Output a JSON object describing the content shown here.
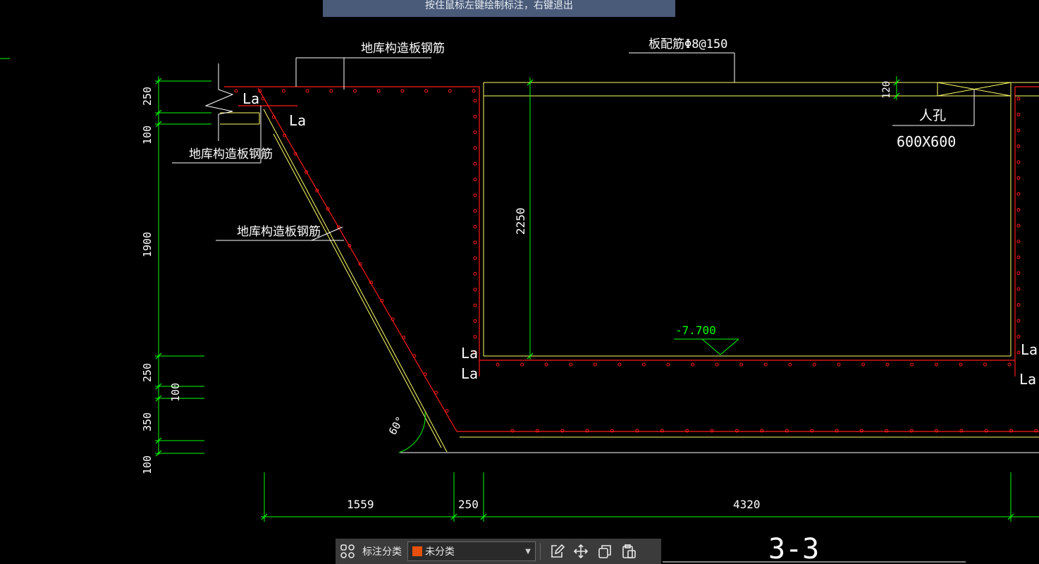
{
  "hint": "按住鼠标左键绘制标注，右键退出",
  "labels": {
    "top_left_note": "地库构造板钢筋",
    "left_note": "地库构造板钢筋",
    "slope_note": "地库构造板钢筋",
    "top_right_note": "板配筋Φ8@150",
    "manhole_name": "人孔",
    "manhole_size": "600X600",
    "la_1": "La",
    "la_2": "La",
    "la_3": "La",
    "la_4": "La",
    "la_5": "La",
    "la_6": "La",
    "elevation": "-7.700",
    "angle": "60°",
    "section": "3-3"
  },
  "dims": {
    "v_250_top": "250",
    "v_100_top": "100",
    "v_1900": "1900",
    "v_250_mid": "250",
    "v_100_mid": "100",
    "v_350": "350",
    "v_100_bot": "100",
    "v_2250": "2250",
    "v_120": "120",
    "h_1559": "1559",
    "h_250": "250",
    "h_4320": "4320"
  },
  "toolbar": {
    "category_label": "标注分类",
    "category_value": "未分类",
    "swatch_color": "#e8500a"
  },
  "colors": {
    "red": "#ff1a1a",
    "yellow": "#ffff66",
    "green": "#00ff00",
    "white": "#ffffff"
  }
}
